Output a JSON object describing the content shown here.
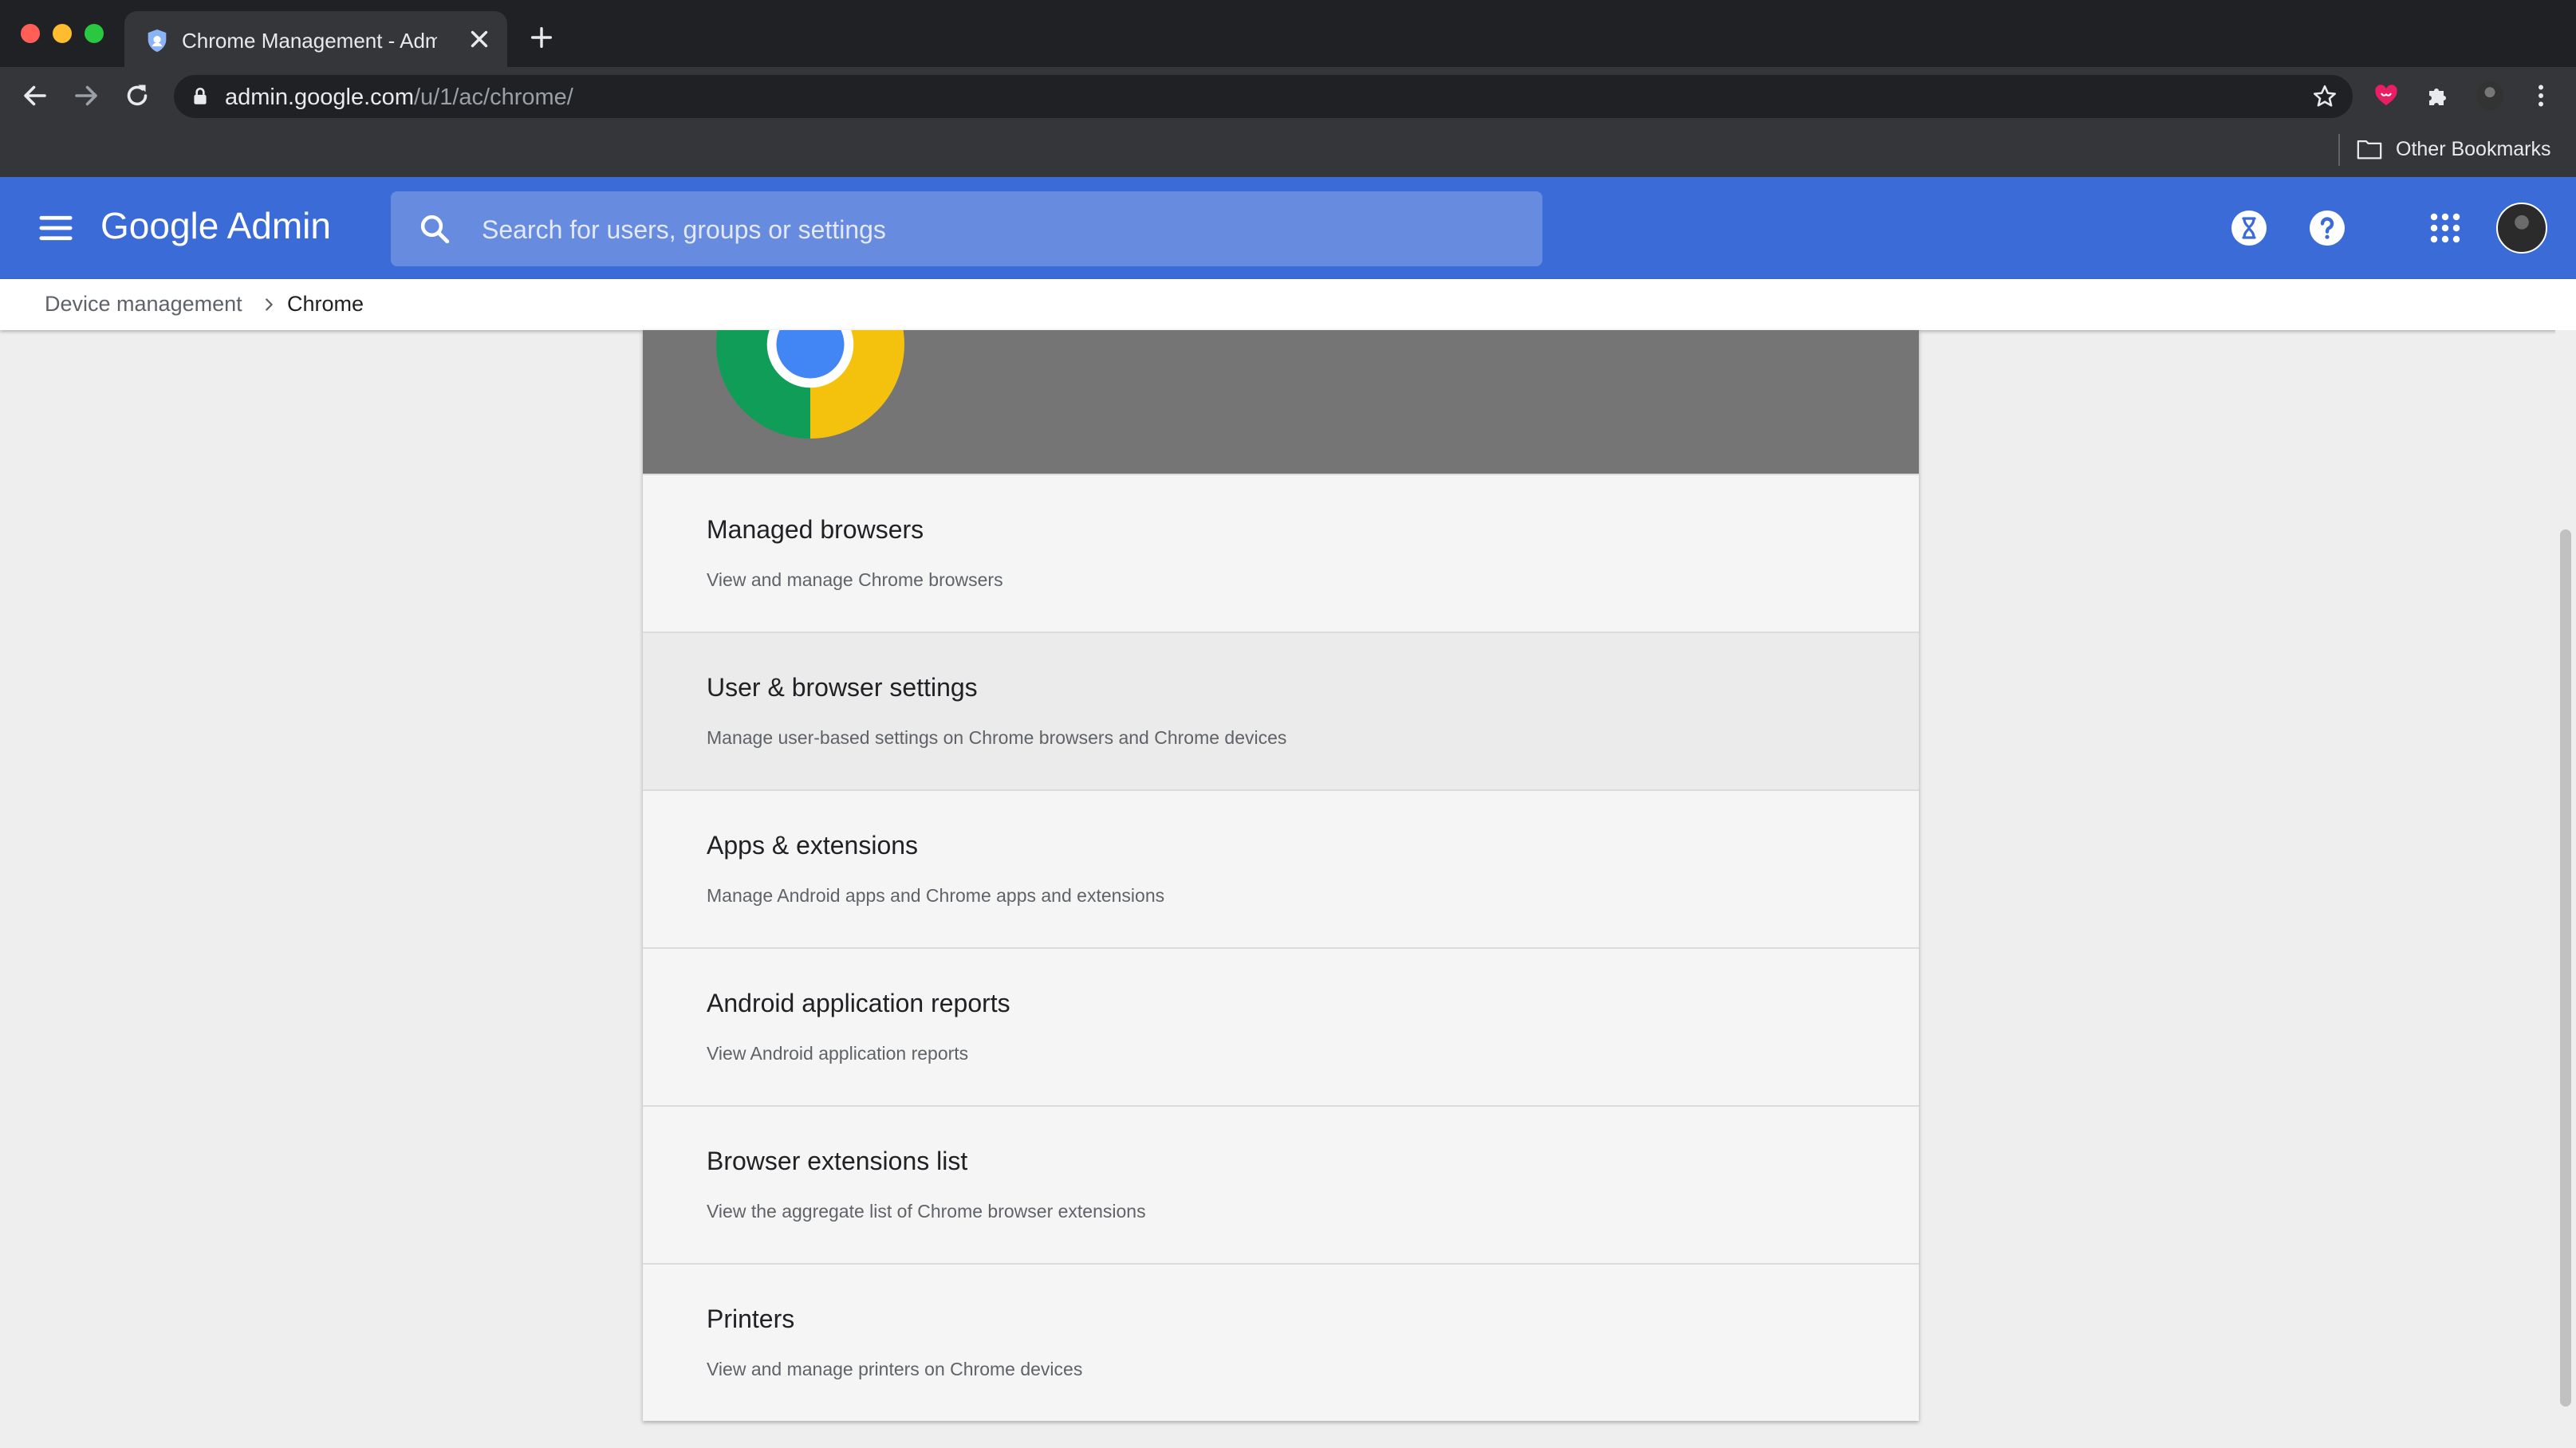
{
  "browser": {
    "tab": {
      "title": "Chrome Management - Admin",
      "favicon": "admin-shield-icon"
    },
    "new_tab_icon": "plus-icon",
    "toolbar": {
      "back_icon": "arrow-left-icon",
      "forward_icon": "arrow-right-icon",
      "reload_icon": "reload-icon",
      "url_host": "admin.google.com",
      "url_path": "/u/1/ac/chrome/",
      "bookmark_icon": "star-icon",
      "extensions": [
        "heart-extension-icon",
        "puzzle-extensions-icon",
        "profile-avatar-icon",
        "more-vert-icon"
      ]
    },
    "bookmarks_bar": {
      "other_bookmarks": "Other Bookmarks"
    }
  },
  "admin_header": {
    "logo_text": "Google Admin",
    "search_placeholder": "Search for users, groups or settings",
    "icons": [
      "menu-icon",
      "search-icon",
      "hourglass-icon",
      "help-icon",
      "apps-grid-icon",
      "account-avatar"
    ],
    "colors": {
      "bar": "#3b6bd6"
    }
  },
  "breadcrumb": {
    "parent": "Device management",
    "current": "Chrome"
  },
  "chrome_page": {
    "items": [
      {
        "title": "Managed browsers",
        "description": "View and manage Chrome browsers"
      },
      {
        "title": "User & browser settings",
        "description": "Manage user-based settings on Chrome browsers and Chrome devices"
      },
      {
        "title": "Apps & extensions",
        "description": "Manage Android apps and Chrome apps and extensions"
      },
      {
        "title": "Android application reports",
        "description": "View Android application reports"
      },
      {
        "title": "Browser extensions list",
        "description": "View the aggregate list of Chrome browser extensions"
      },
      {
        "title": "Printers",
        "description": "View and manage printers on Chrome devices"
      }
    ],
    "hovered_item_index": 1
  }
}
